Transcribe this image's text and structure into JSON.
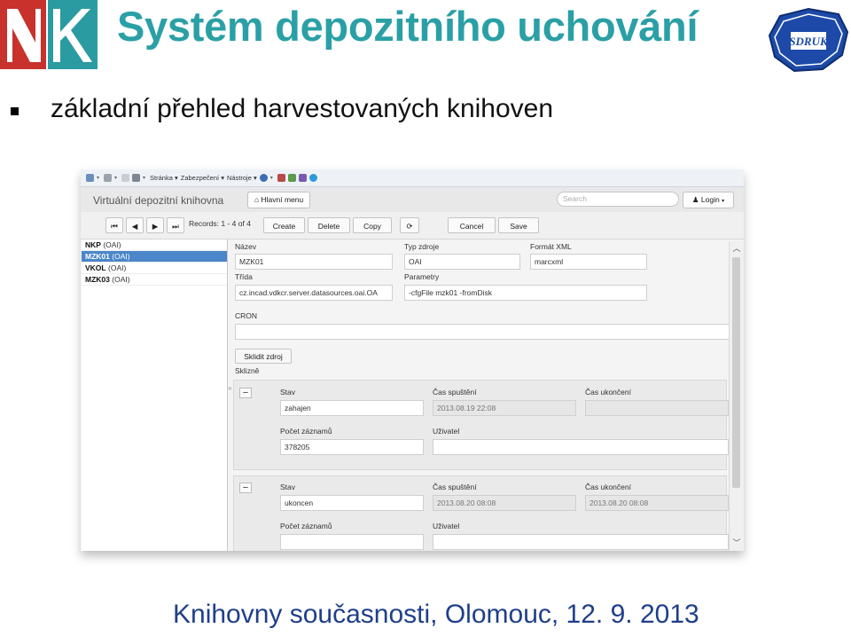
{
  "slide": {
    "title": "Systém depozitního uchování",
    "bullet": "základní přehled harvestovaných knihoven",
    "footer": "Knihovny současnosti, Olomouc, 12. 9. 2013",
    "logo_left_text": "NK",
    "logo_right_text": "SDRUK"
  },
  "browser": {
    "menus": [
      "Stránka ▾",
      "Zabezpečení ▾",
      "Nástroje ▾"
    ]
  },
  "app": {
    "brand": "Virtuální depozitní knihovna",
    "main_menu_label": "Hlavní menu",
    "search_placeholder": "Search",
    "login_label": "Login"
  },
  "toolbar": {
    "records_text": "Records: 1 - 4 of 4",
    "create_label": "Create",
    "delete_label": "Delete",
    "copy_label": "Copy",
    "cancel_label": "Cancel",
    "save_label": "Save"
  },
  "libraries": [
    {
      "code": "NKP",
      "type": "(OAI)",
      "selected": false
    },
    {
      "code": "MZK01",
      "type": "(OAI)",
      "selected": true
    },
    {
      "code": "VKOL",
      "type": "(OAI)",
      "selected": false
    },
    {
      "code": "MZK03",
      "type": "(OAI)",
      "selected": false
    }
  ],
  "form": {
    "nazev_label": "Název",
    "nazev_value": "MZK01",
    "typ_label": "Typ zdroje",
    "typ_value": "OAI",
    "format_label": "Formát XML",
    "format_value": "marcxml",
    "trida_label": "Třída",
    "trida_value": "cz.incad.vdkcr.server.datasources.oai.OA",
    "parametry_label": "Parametry",
    "parametry_value": "-cfgFile mzk01 -fromDisk",
    "cron_label": "CRON",
    "cron_value": "",
    "harvest_button": "Sklidit zdroj",
    "sklizne_label": "Sklizně"
  },
  "harvests": [
    {
      "stav_label": "Stav",
      "stav": "zahajen",
      "start_label": "Čas spuštění",
      "start": "2013.08.19 22:08",
      "end_label": "Čas ukončení",
      "end": "",
      "count_label": "Počet záznamů",
      "count": "378205",
      "user_label": "Uživatel",
      "user": ""
    },
    {
      "stav_label": "Stav",
      "stav": "ukoncen",
      "start_label": "Čas spuštění",
      "start": "2013.08.20 08:08",
      "end_label": "Čas ukončení",
      "end": "2013.08.20 08:08",
      "count_label": "Počet záznamů",
      "count": "",
      "user_label": "Uživatel",
      "user": ""
    }
  ],
  "colors": {
    "title": "#2aa0a6",
    "nk_red": "#c8312c",
    "nk_teal": "#2a9ba0",
    "footer": "#1f3f8a",
    "selection": "#4a86c8"
  },
  "icons": {
    "nav_first": "⏮",
    "nav_prev": "◀",
    "nav_next": "▶",
    "nav_last": "⏭",
    "refresh": "⟳",
    "minus": "−",
    "home": "⌂",
    "user": "♟"
  }
}
